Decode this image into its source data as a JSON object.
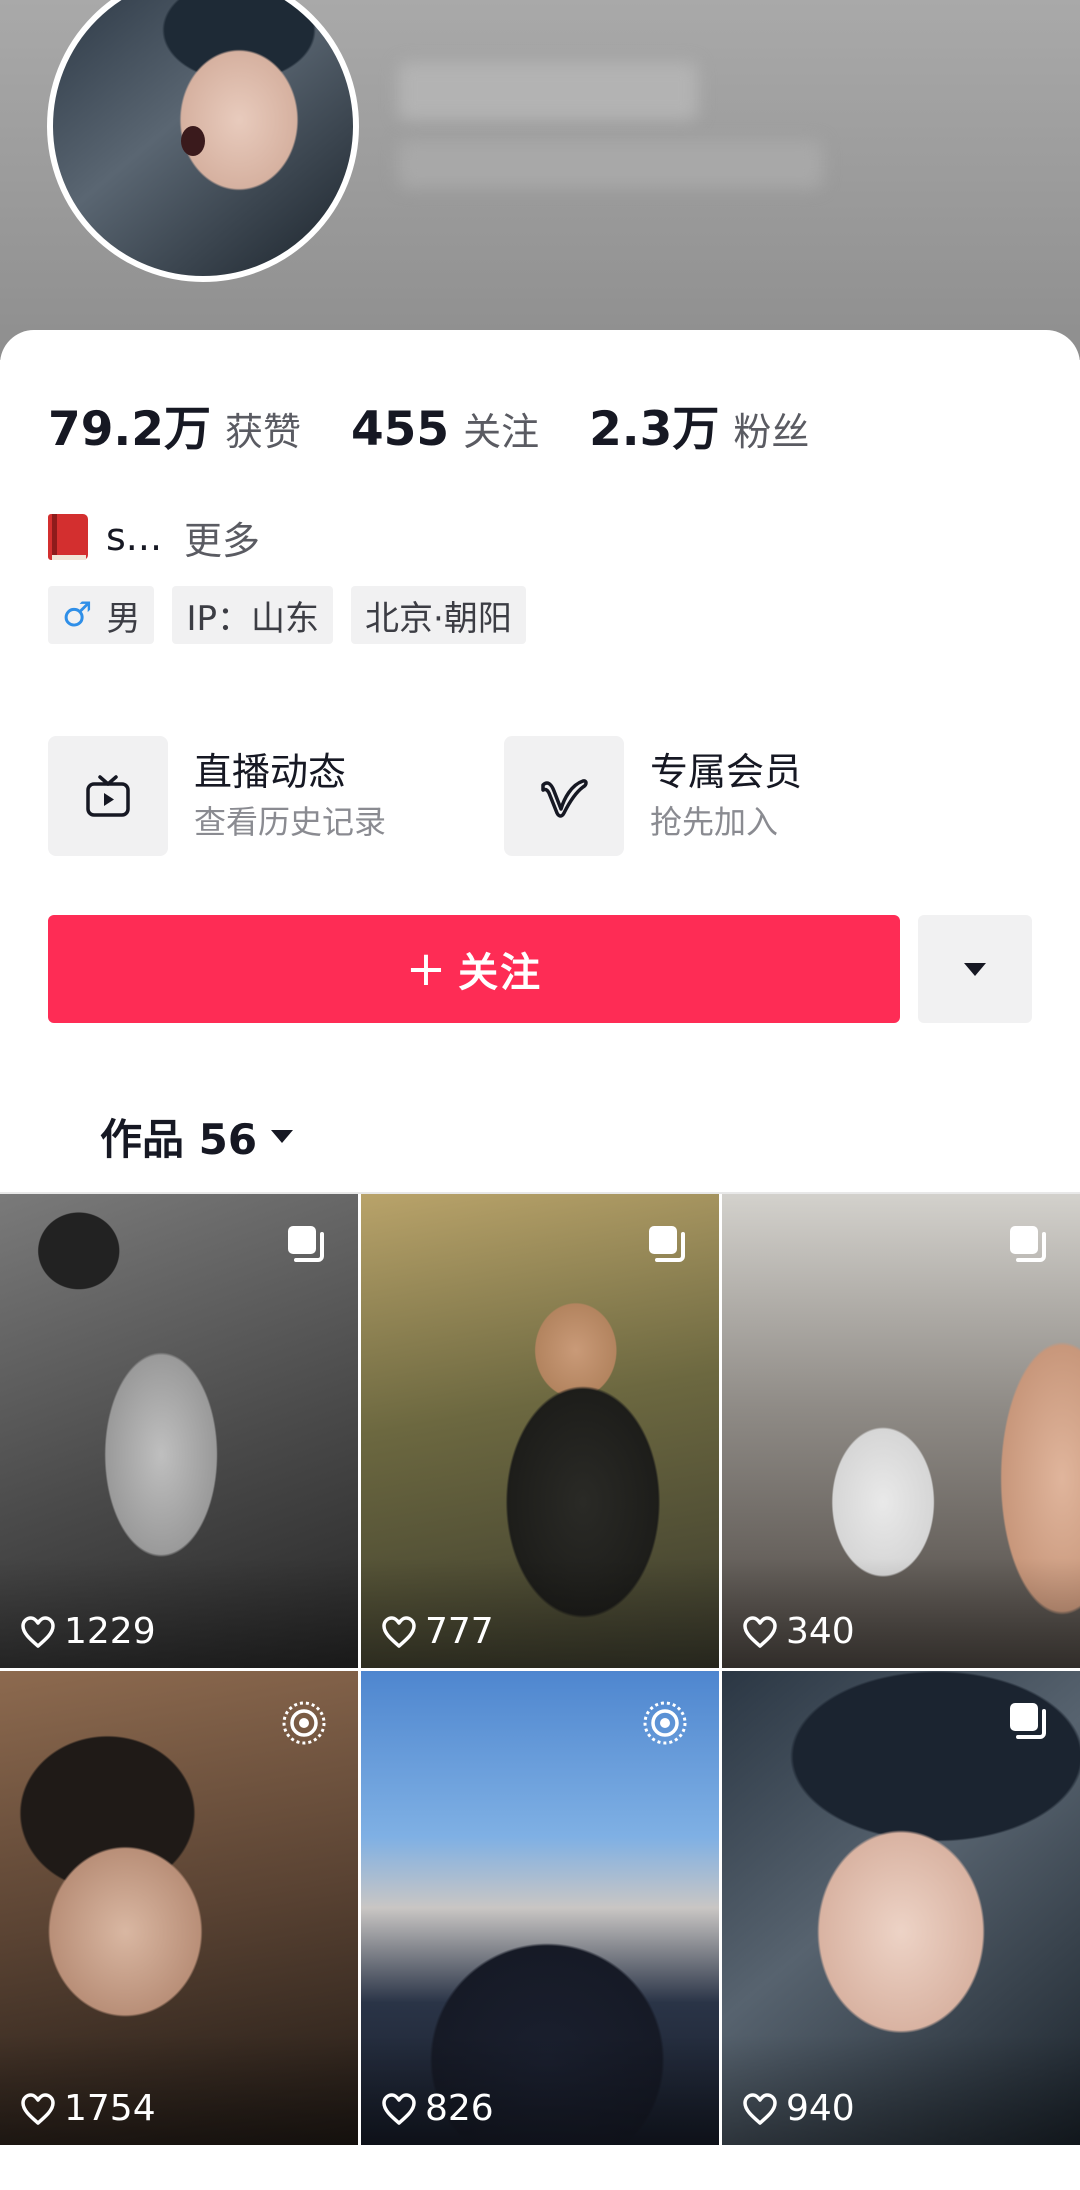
{
  "stats": [
    {
      "value": "79.2万",
      "label": "获赞"
    },
    {
      "value": "455",
      "label": "关注"
    },
    {
      "value": "2.3万",
      "label": "粉丝"
    }
  ],
  "bio": {
    "icon": "book-icon",
    "text": "s...",
    "more": "更多"
  },
  "tags": {
    "gender_icon": "male-icon",
    "gender_symbol": "♂",
    "gender": "男",
    "ip": "IP：山东",
    "location": "北京·朝阳"
  },
  "features": [
    {
      "icon": "live-tv-icon",
      "title": "直播动态",
      "subtitle": "查看历史记录"
    },
    {
      "icon": "v-badge-icon",
      "title": "专属会员",
      "subtitle": "抢先加入"
    }
  ],
  "follow_button": {
    "plus": "+",
    "label": "关注",
    "color": "#fe2c55"
  },
  "works_tab": {
    "label": "作品 56"
  },
  "grid": [
    {
      "likes": "1229",
      "badge": "multi-image-icon"
    },
    {
      "likes": "777",
      "badge": "multi-image-icon"
    },
    {
      "likes": "340",
      "badge": "multi-image-icon"
    },
    {
      "likes": "1754",
      "badge": "live-photo-icon"
    },
    {
      "likes": "826",
      "badge": "live-photo-icon"
    },
    {
      "likes": "940",
      "badge": "multi-image-icon"
    }
  ]
}
